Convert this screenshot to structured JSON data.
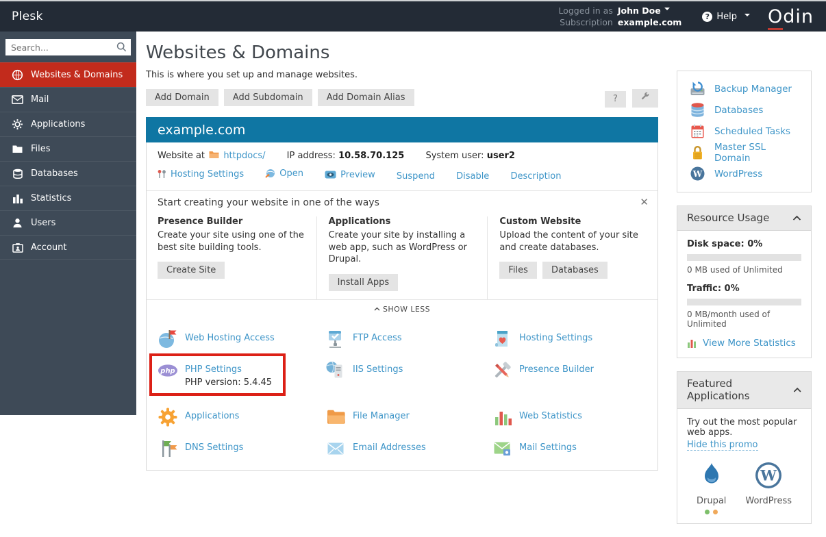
{
  "topbar": {
    "brand": "Plesk",
    "logged_in_as_label": "Logged in as",
    "user": "John Doe",
    "subscription_label": "Subscription",
    "subscription": "example.com",
    "help_label": "Help",
    "logo_o": "O",
    "logo_rest": "din"
  },
  "sidebar": {
    "search_placeholder": "Search...",
    "items": [
      {
        "label": "Websites & Domains",
        "icon": "globe-icon",
        "active": true
      },
      {
        "label": "Mail",
        "icon": "mail-icon",
        "active": false
      },
      {
        "label": "Applications",
        "icon": "gear-icon",
        "active": false
      },
      {
        "label": "Files",
        "icon": "folder-icon",
        "active": false
      },
      {
        "label": "Databases",
        "icon": "database-icon",
        "active": false
      },
      {
        "label": "Statistics",
        "icon": "bar-chart-icon",
        "active": false
      },
      {
        "label": "Users",
        "icon": "user-icon",
        "active": false
      },
      {
        "label": "Account",
        "icon": "id-card-icon",
        "active": false
      }
    ]
  },
  "page": {
    "title": "Websites & Domains",
    "subtitle": "This is where you set up and manage websites.",
    "toolbar": [
      "Add Domain",
      "Add Subdomain",
      "Add Domain Alias"
    ],
    "help_button": "?"
  },
  "domain": {
    "name": "example.com",
    "website_at_label": "Website at",
    "docroot": "httpdocs/",
    "ip_label": "IP address:",
    "ip": "10.58.70.125",
    "system_user_label": "System user:",
    "system_user": "user2",
    "actions": [
      "Hosting Settings",
      "Open",
      "Preview",
      "Suspend",
      "Disable",
      "Description"
    ]
  },
  "promo": {
    "title": "Start creating your website in one of the ways",
    "close_label": "✕",
    "columns": [
      {
        "title": "Presence Builder",
        "text": "Create your site using one of the best site building tools.",
        "buttons": [
          "Create Site"
        ]
      },
      {
        "title": "Applications",
        "text": "Create your site by installing a web app, such as WordPress or Drupal.",
        "buttons": [
          "Install Apps"
        ]
      },
      {
        "title": "Custom Website",
        "text": "Upload the content of your site and create databases.",
        "buttons": [
          "Files",
          "Databases"
        ]
      }
    ],
    "collapse_label": "SHOW LESS"
  },
  "tools": [
    {
      "label": "Web Hosting Access",
      "icon": "web-hosting-access-icon"
    },
    {
      "label": "FTP Access",
      "icon": "ftp-access-icon"
    },
    {
      "label": "Hosting Settings",
      "icon": "hosting-settings-icon"
    },
    {
      "label": "PHP Settings",
      "sub": "PHP version: 5.4.45",
      "icon": "php-icon",
      "highlighted": true
    },
    {
      "label": "IIS Settings",
      "icon": "iis-icon"
    },
    {
      "label": "Presence Builder",
      "icon": "presence-builder-icon"
    },
    {
      "label": "Applications",
      "icon": "applications-gear-icon"
    },
    {
      "label": "File Manager",
      "icon": "file-manager-icon"
    },
    {
      "label": "Web Statistics",
      "icon": "web-statistics-icon"
    },
    {
      "label": "DNS Settings",
      "icon": "dns-flags-icon"
    },
    {
      "label": "Email Addresses",
      "icon": "email-envelope-icon"
    },
    {
      "label": "Mail Settings",
      "icon": "mail-settings-icon"
    }
  ],
  "shortcuts": [
    {
      "label": "Backup Manager",
      "icon": "backup-icon"
    },
    {
      "label": "Databases",
      "icon": "databases-icon"
    },
    {
      "label": "Scheduled Tasks",
      "icon": "calendar-icon"
    },
    {
      "label": "Master SSL Domain",
      "icon": "lock-icon"
    },
    {
      "label": "WordPress",
      "icon": "wordpress-icon"
    }
  ],
  "resource_usage": {
    "title": "Resource Usage",
    "disk_label": "Disk space: 0%",
    "disk_percent": 0,
    "disk_note": "0 MB used of Unlimited",
    "traffic_label": "Traffic: 0%",
    "traffic_percent": 0,
    "traffic_note": "0 MB/month used of Unlimited",
    "link_label": "View More Statistics"
  },
  "featured": {
    "title": "Featured Applications",
    "text": "Try out the most popular web apps.",
    "hide_link": "Hide this promo",
    "apps": [
      {
        "label": "Drupal",
        "icon": "drupal-icon"
      },
      {
        "label": "WordPress",
        "icon": "wordpress-icon"
      }
    ]
  },
  "colors": {
    "topbar": "#232b36",
    "sidebar": "#3e4a57",
    "active_red": "#c22b1c",
    "header_blue": "#0f76a3",
    "link_blue": "#3e95c8",
    "highlight_red": "#dc2016"
  }
}
